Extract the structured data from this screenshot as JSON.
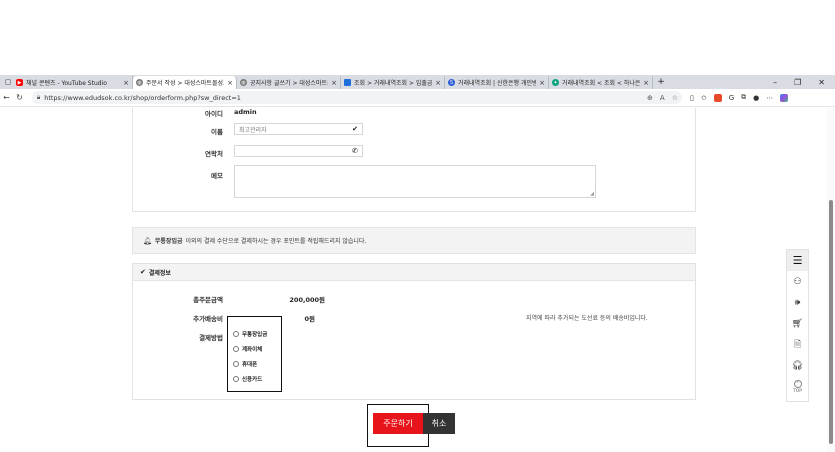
{
  "tabs": [
    {
      "title": "채널 콘텐츠 - YouTube Studio",
      "icon": "youtube-icon",
      "color": "#ff0000",
      "active": false
    },
    {
      "title": "주문서 작성 > 대성스마트몰성고",
      "icon": "globe-icon",
      "color": "#555555",
      "active": true
    },
    {
      "title": "공지사항 글쓰기 > 대성스마트몰",
      "icon": "globe-icon",
      "color": "#555555",
      "active": false
    },
    {
      "title": "조회 > 거래내역조회 > 입출금거",
      "icon": "bank-icon",
      "color": "#1e6fd9",
      "active": false
    },
    {
      "title": "거래내역조회 | 신한은행 개인뱅",
      "icon": "shinhan-icon",
      "color": "#2a5bd7",
      "active": false
    },
    {
      "title": "거래내역조회 < 조회 < 하나은행",
      "icon": "hana-icon",
      "color": "#00a37a",
      "active": false
    }
  ],
  "browser": {
    "url": "https://www.edudsok.co.kr/shop/orderform.php?sw_direct=1"
  },
  "form": {
    "id_label": "아이디",
    "id_value": "admin",
    "name_label": "이름",
    "name_value": "최고관리자",
    "phone_label": "연락처",
    "phone_value": "",
    "memo_label": "메모"
  },
  "notice": {
    "bold": "무통장입금",
    "text": "이외의 결제 수단으로 결제하시는 경우 포인트를 적립해드리지 않습니다."
  },
  "payment": {
    "title": "결제정보",
    "total_label": "총주문금액",
    "total_value": "200,000원",
    "extra_label": "추가배송비",
    "extra_value": "0원",
    "extra_note": "지역에 따라 추가되는 도선료 등의 배송비입니다.",
    "method_label": "결제방법",
    "methods": [
      "무통장입금",
      "계좌이체",
      "휴대폰",
      "신용카드"
    ]
  },
  "buttons": {
    "order": "주문하기",
    "cancel": "취소"
  },
  "quick_menu": {
    "top_label": "TOP"
  },
  "colors": {
    "order_button": "#e8141b",
    "cancel_button": "#333333"
  }
}
